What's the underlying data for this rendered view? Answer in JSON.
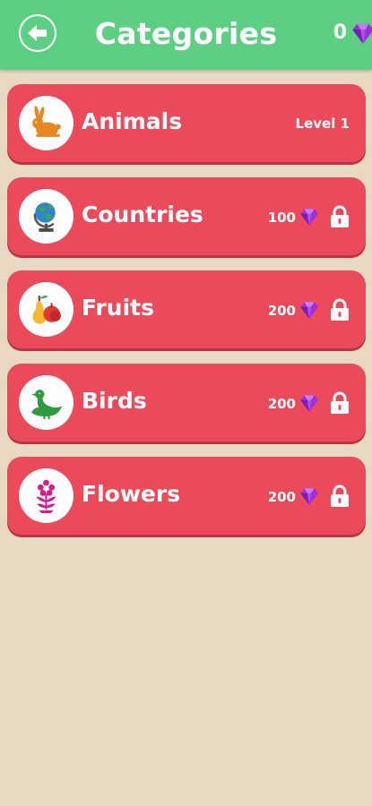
{
  "header": {
    "title": "Categories",
    "gem_count": "0",
    "back_icon": "arrow-left-icon",
    "gem_icon": "diamond-icon",
    "background": "#5ccf82"
  },
  "categories": [
    {
      "label": "Animals",
      "status": "Level 1",
      "locked": false,
      "icon": "rabbit-icon"
    },
    {
      "label": "Countries",
      "price": "100",
      "locked": true,
      "icon": "globe-icon"
    },
    {
      "label": "Fruits",
      "price": "200",
      "locked": true,
      "icon": "fruits-icon"
    },
    {
      "label": "Birds",
      "price": "200",
      "locked": true,
      "icon": "duck-icon"
    },
    {
      "label": "Flowers",
      "price": "200",
      "locked": true,
      "icon": "flower-icon"
    }
  ],
  "colors": {
    "card": "#ea4a5a",
    "page_background": "#e8d9c3",
    "gem": "#9b2fd8"
  }
}
